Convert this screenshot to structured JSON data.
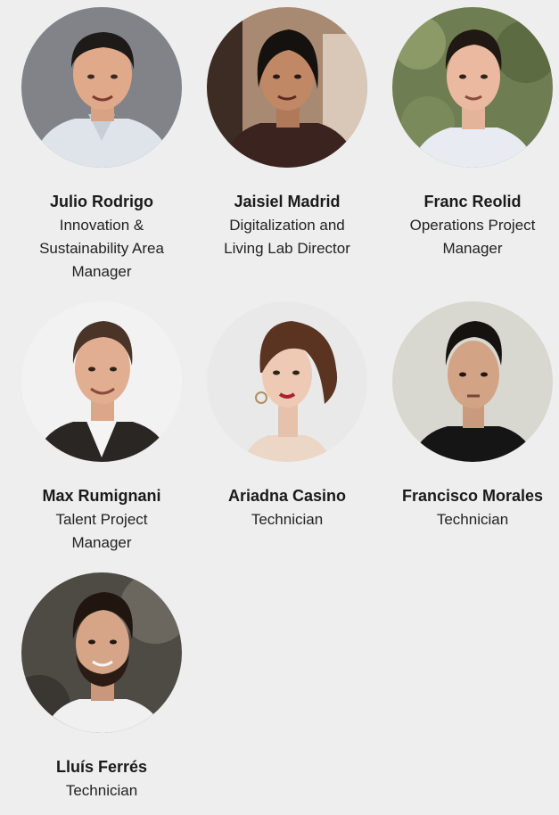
{
  "team": [
    {
      "name": "Julio Rodrigo",
      "role": "Innovation &\nSustainability Area\nManager",
      "photo": "portrait-julio-rodrigo"
    },
    {
      "name": "Jaisiel Madrid",
      "role": "Digitalization and\nLiving Lab Director",
      "photo": "portrait-jaisiel-madrid"
    },
    {
      "name": "Franc Reolid",
      "role": "Operations Project\nManager",
      "photo": "portrait-franc-reolid"
    },
    {
      "name": "Max Rumignani",
      "role": "Talent Project\nManager",
      "photo": "portrait-max-rumignani"
    },
    {
      "name": "Ariadna Casino",
      "role": "Technician",
      "photo": "portrait-ariadna-casino"
    },
    {
      "name": "Francisco Morales",
      "role": "Technician",
      "photo": "portrait-francisco-morales"
    },
    {
      "name": "Lluís Ferrés",
      "role": "Technician",
      "photo": "portrait-lluis-ferres"
    }
  ],
  "colors": {
    "page_background": "#eeeeee",
    "text": "#1a1a1a"
  }
}
